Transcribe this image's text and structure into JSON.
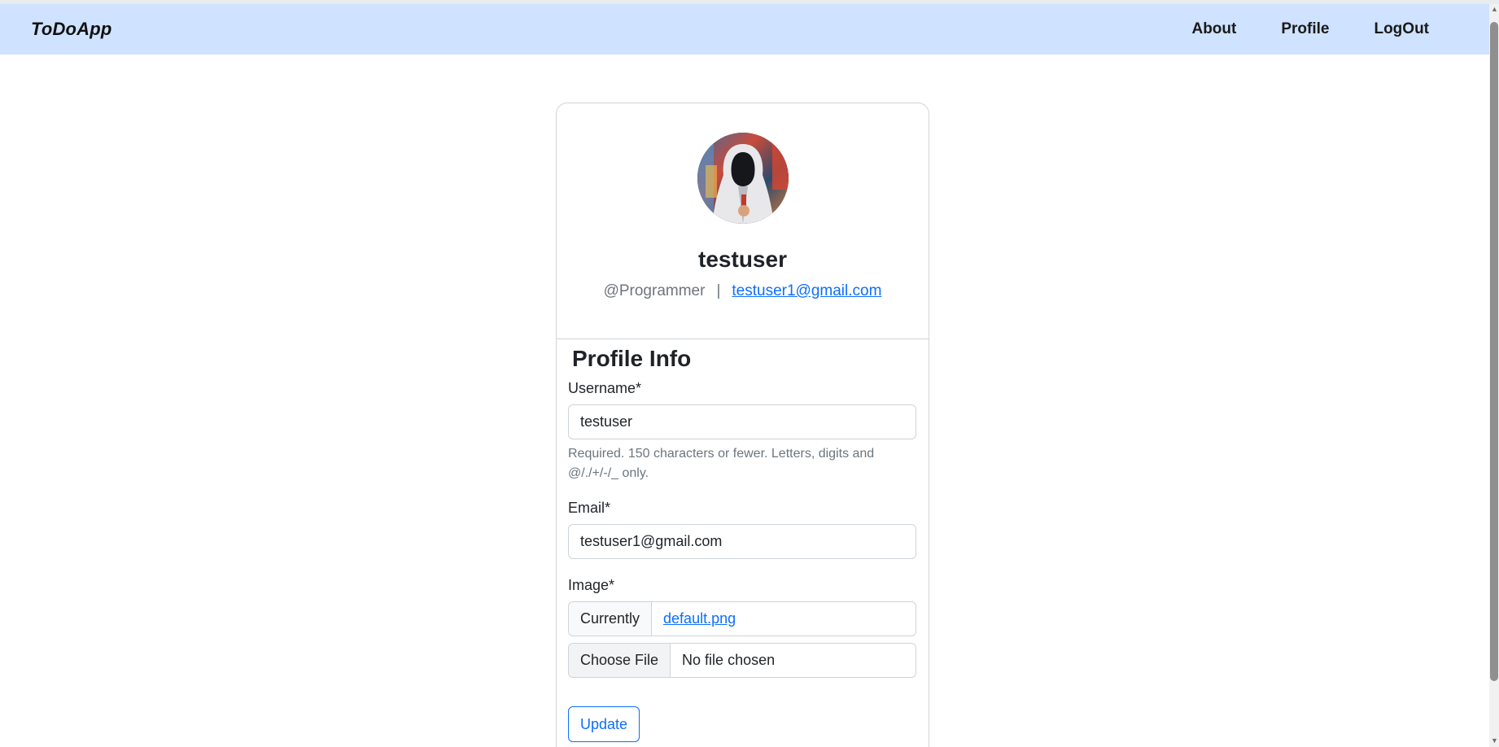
{
  "app": {
    "brand": "ToDoApp"
  },
  "nav": {
    "links": [
      {
        "label": "About"
      },
      {
        "label": "Profile"
      },
      {
        "label": "LogOut"
      }
    ]
  },
  "profile_header": {
    "username": "testuser",
    "handle": "@Programmer",
    "separator": "|",
    "email": "testuser1@gmail.com",
    "avatar_icon": "hooded-figure-avatar"
  },
  "form": {
    "title": "Profile Info",
    "username_label": "Username*",
    "username_value": "testuser",
    "username_help": "Required. 150 characters or fewer. Letters, digits and @/./+/-/_ only.",
    "email_label": "Email*",
    "email_value": "testuser1@gmail.com",
    "image_label": "Image*",
    "currently_label": "Currently",
    "current_file": "default.png",
    "choose_file_label": "Choose File",
    "no_file_text": "No file chosen",
    "submit_label": "Update"
  },
  "colors": {
    "navbar_bg": "#cfe2ff",
    "link": "#0d6efd",
    "muted": "#6c757d"
  }
}
